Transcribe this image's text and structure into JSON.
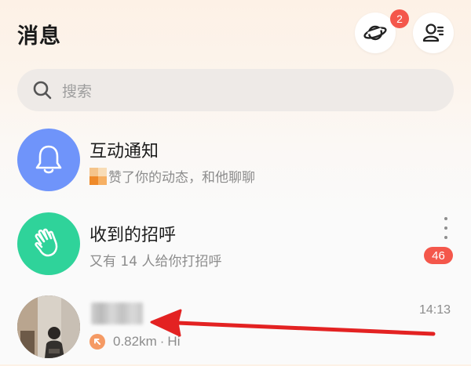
{
  "header": {
    "title": "消息",
    "planet_badge": "2"
  },
  "search": {
    "placeholder": "搜索"
  },
  "conversations": [
    {
      "title": "互动通知",
      "subtitle": "赞了你的动态，和他聊聊",
      "icon": "bell-icon",
      "avatar_color": "#6f94fa"
    },
    {
      "title": "收到的招呼",
      "subtitle": "又有 14 人给你打招呼",
      "icon": "waving-hand-icon",
      "avatar_color": "#2fd39a",
      "unread": "46"
    },
    {
      "title": "",
      "distance": "0.82km",
      "separator": "·",
      "preview": "Hi",
      "time": "14:13",
      "icon": "location-arrow-icon",
      "accent": "#f59a64"
    }
  ],
  "colors": {
    "badge": "#f4574b",
    "annotation_arrow": "#e32222"
  }
}
